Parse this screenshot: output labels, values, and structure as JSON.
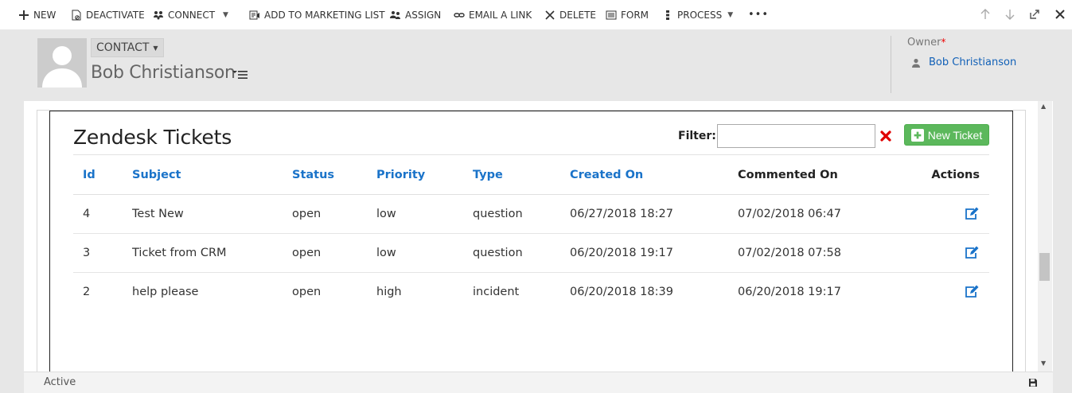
{
  "command_bar": {
    "items": [
      {
        "label": "NEW",
        "icon": "plus-icon"
      },
      {
        "label": "DEACTIVATE",
        "icon": "deactivate-icon"
      },
      {
        "label": "CONNECT",
        "icon": "connect-icon"
      },
      {
        "label": "ADD TO MARKETING LIST",
        "icon": "marketing-list-icon"
      },
      {
        "label": "ASSIGN",
        "icon": "assign-icon"
      },
      {
        "label": "EMAIL A LINK",
        "icon": "link-icon"
      },
      {
        "label": "DELETE",
        "icon": "delete-icon"
      },
      {
        "label": "FORM",
        "icon": "form-icon"
      },
      {
        "label": "PROCESS",
        "icon": "process-icon"
      }
    ],
    "more": "•••"
  },
  "header": {
    "entity_type": "CONTACT",
    "record_name": "Bob Christianson",
    "owner_label": "Owner",
    "owner_required": "*",
    "owner_value": "Bob Christianson"
  },
  "widget": {
    "title": "Zendesk Tickets",
    "filter_label": "Filter:",
    "filter_value": "",
    "new_ticket_label": "New Ticket",
    "columns": [
      "Id",
      "Subject",
      "Status",
      "Priority",
      "Type",
      "Created On",
      "Commented On",
      "Actions"
    ],
    "rows": [
      {
        "id": "4",
        "subject": "Test New",
        "status": "open",
        "priority": "low",
        "type": "question",
        "created_on": "06/27/2018 18:27",
        "commented_on": "07/02/2018 06:47"
      },
      {
        "id": "3",
        "subject": "Ticket from CRM",
        "status": "open",
        "priority": "low",
        "type": "question",
        "created_on": "06/20/2018 19:17",
        "commented_on": "07/02/2018 07:58"
      },
      {
        "id": "2",
        "subject": "help please",
        "status": "open",
        "priority": "high",
        "type": "incident",
        "created_on": "06/20/2018 18:39",
        "commented_on": "06/20/2018 19:17"
      }
    ]
  },
  "footer": {
    "status": "Active"
  },
  "colors": {
    "link_blue": "#1a73c9",
    "new_ticket_green": "#5cb85c",
    "clear_red": "#e00000",
    "header_gray": "#e7e7e7"
  }
}
